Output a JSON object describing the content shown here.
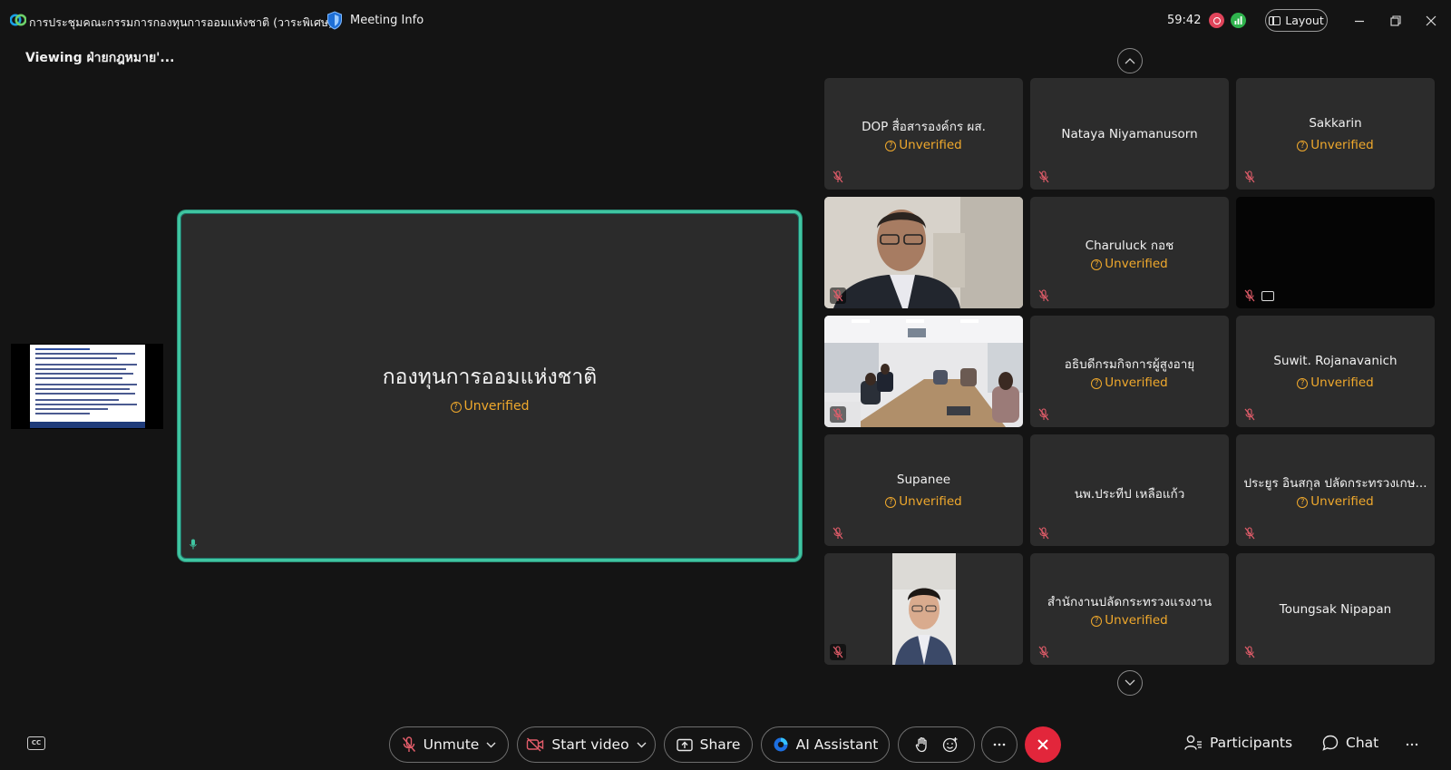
{
  "titlebar": {
    "meeting_title": "การประชุมคณะกรรมการกองทุนการออมแห่งชาติ (วาระพิเศษ)",
    "meeting_info": "Meeting Info",
    "timer": "59:42",
    "layout_label": "Layout"
  },
  "viewing": "Viewing ฝ่ายกฎหมาย'...",
  "stage": {
    "name": "กองทุนการออมแห่งชาติ",
    "status": "Unverified"
  },
  "tiles": [
    {
      "name": "DOP สื่อสารองค์กร ผส.",
      "status": "Unverified"
    },
    {
      "name": "Nataya Niyamanusorn",
      "status": ""
    },
    {
      "name": "Sakkarin",
      "status": "Unverified"
    },
    {
      "name": "",
      "status": ""
    },
    {
      "name": "Charuluck กอช",
      "status": "Unverified"
    },
    {
      "name": "",
      "status": ""
    },
    {
      "name": "",
      "status": ""
    },
    {
      "name": "อธิบดีกรมกิจการผู้สูงอายุ",
      "status": "Unverified"
    },
    {
      "name": "Suwit. Rojanavanich",
      "status": "Unverified"
    },
    {
      "name": "Supanee",
      "status": "Unverified"
    },
    {
      "name": "นพ.ประทีป เหลือแก้ว",
      "status": ""
    },
    {
      "name": "ประยูร อินสกุล ปลัดกระทรวงเกษ...",
      "status": "Unverified"
    },
    {
      "name": "",
      "status": ""
    },
    {
      "name": "สำนักงานปลัดกระทรวงแรงงาน",
      "status": "Unverified"
    },
    {
      "name": "Toungsak Nipapan",
      "status": ""
    }
  ],
  "toolbar": {
    "unmute": "Unmute",
    "start_video": "Start video",
    "share": "Share",
    "ai_assistant": "AI Assistant",
    "cc": "CC",
    "participants": "Participants",
    "chat": "Chat"
  },
  "colors": {
    "stage_border": "#3fc5a1",
    "unverified": "#f0a92c",
    "end_call": "#e2263b",
    "mute_red": "#e35d6a"
  }
}
